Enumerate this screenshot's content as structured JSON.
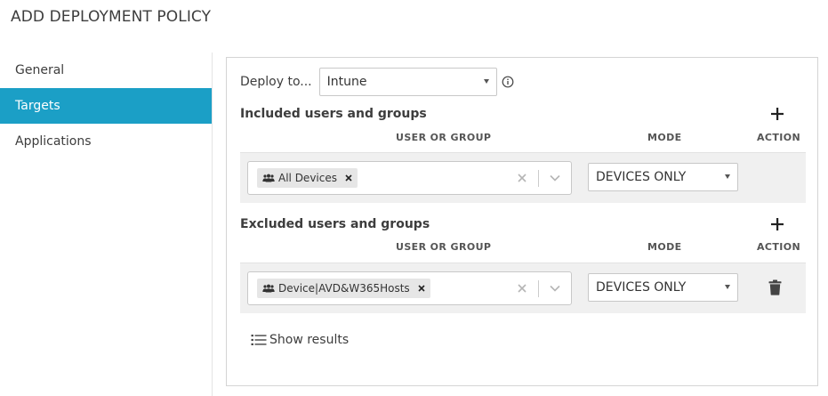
{
  "page": {
    "title": "ADD DEPLOYMENT POLICY"
  },
  "sidebar": {
    "items": [
      {
        "label": "General",
        "active": false
      },
      {
        "label": "Targets",
        "active": true
      },
      {
        "label": "Applications",
        "active": false
      }
    ]
  },
  "deploy": {
    "label": "Deploy to...",
    "value": "Intune",
    "info_icon": "info-circle-icon"
  },
  "included": {
    "title": "Included users and groups",
    "col_user": "USER OR GROUP",
    "col_mode": "MODE",
    "col_action": "ACTION",
    "add_icon": "plus-icon",
    "row": {
      "chip_label": "All Devices",
      "chip_icon": "users-group-icon",
      "mode": "DEVICES ONLY"
    }
  },
  "excluded": {
    "title": "Excluded users and groups",
    "col_user": "USER OR GROUP",
    "col_mode": "MODE",
    "col_action": "ACTION",
    "add_icon": "plus-icon",
    "row": {
      "chip_label": "Device|AVD&W365Hosts",
      "chip_icon": "users-group-icon",
      "mode": "DEVICES ONLY",
      "action_icon": "trash-icon"
    }
  },
  "footer": {
    "show_results_label": "Show results",
    "show_results_icon": "list-icon"
  },
  "colors": {
    "accent": "#1b9fc6",
    "band": "#f0f0f0",
    "border": "#c8c8c8"
  }
}
